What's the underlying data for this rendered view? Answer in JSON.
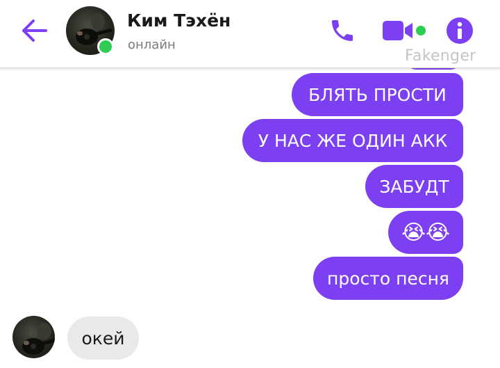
{
  "header": {
    "contact_name": "Ким Тэхён",
    "status": "онлайн",
    "watermark": "Fakenger",
    "icons": {
      "back": "arrow-left-icon",
      "call": "phone-icon",
      "video": "video-camera-icon",
      "info": "info-icon"
    }
  },
  "messages": [
    {
      "direction": "out",
      "text": "БЛЯТЬ ПРОСТИ"
    },
    {
      "direction": "out",
      "text": "У НАС ЖЕ ОДИН АКК"
    },
    {
      "direction": "out",
      "text": "ЗАБУДТ"
    },
    {
      "direction": "out",
      "text": "😭😭"
    },
    {
      "direction": "out",
      "text": "просто песня"
    },
    {
      "direction": "in",
      "text": "окей"
    }
  ],
  "colors": {
    "accent": "#7c3ff2",
    "online": "#2ecc53",
    "incoming_bubble": "#e9e9eb",
    "watermark": "#c4c4c4"
  }
}
